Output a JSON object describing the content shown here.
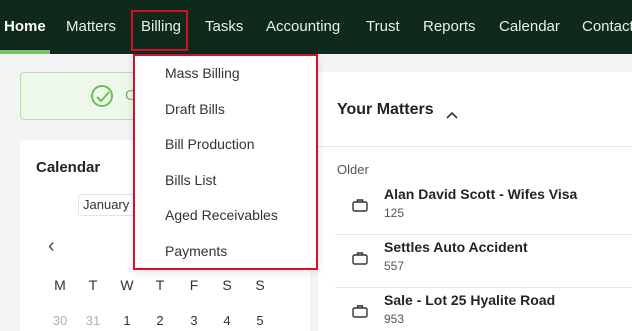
{
  "nav": {
    "items": [
      {
        "label": "Home",
        "active": true
      },
      {
        "label": "Matters"
      },
      {
        "label": "Billing"
      },
      {
        "label": "Tasks"
      },
      {
        "label": "Accounting"
      },
      {
        "label": "Trust"
      },
      {
        "label": "Reports"
      },
      {
        "label": "Calendar"
      },
      {
        "label": "Contact"
      }
    ]
  },
  "billing_menu": {
    "items": [
      "Mass Billing",
      "Draft Bills",
      "Bill Production",
      "Bills List",
      "Aged Receivables",
      "Payments"
    ]
  },
  "banner": {
    "icon": "check-circle-icon",
    "text": "C"
  },
  "calendar": {
    "title": "Calendar",
    "month": "January",
    "prev_icon": "chevron-left-icon",
    "weekdays": [
      "M",
      "T",
      "W",
      "T",
      "F",
      "S",
      "S"
    ],
    "days": [
      {
        "n": "30",
        "muted": true
      },
      {
        "n": "31",
        "muted": true
      },
      {
        "n": "1"
      },
      {
        "n": "2"
      },
      {
        "n": "3"
      },
      {
        "n": "4"
      },
      {
        "n": "5"
      }
    ]
  },
  "matters": {
    "title": "Your Matters",
    "toggle_icon": "chevron-up-icon",
    "group_label": "Older",
    "items": [
      {
        "name": "Alan David Scott - Wifes Visa",
        "number": "125",
        "icon": "briefcase-icon"
      },
      {
        "name": "Settles Auto Accident",
        "number": "557",
        "icon": "briefcase-icon"
      },
      {
        "name": "Sale - Lot 25 Hyalite Road",
        "number": "953",
        "icon": "briefcase-icon"
      }
    ]
  },
  "colors": {
    "nav_bg": "#0f2a1d",
    "nav_active_underline": "#7ac36a",
    "highlight_border": "#d0132a",
    "success": "#6bbf59"
  }
}
